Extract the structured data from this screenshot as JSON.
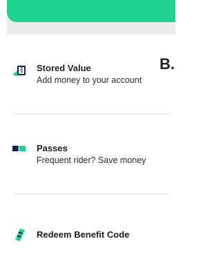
{
  "step_marker": "B.",
  "items": [
    {
      "title": "Stored Value",
      "subtitle": "Add money to your account",
      "icon": "stored-value-card-icon"
    },
    {
      "title": "Passes",
      "subtitle": "Frequent rider? Save money",
      "icon": "pass-ticket-icon"
    },
    {
      "title": "Redeem Benefit Code",
      "subtitle": "",
      "icon": "benefit-code-icon"
    }
  ],
  "colors": {
    "accent": "#1fd38f",
    "icon_dark": "#14204f",
    "icon_green": "#1fd38f"
  }
}
